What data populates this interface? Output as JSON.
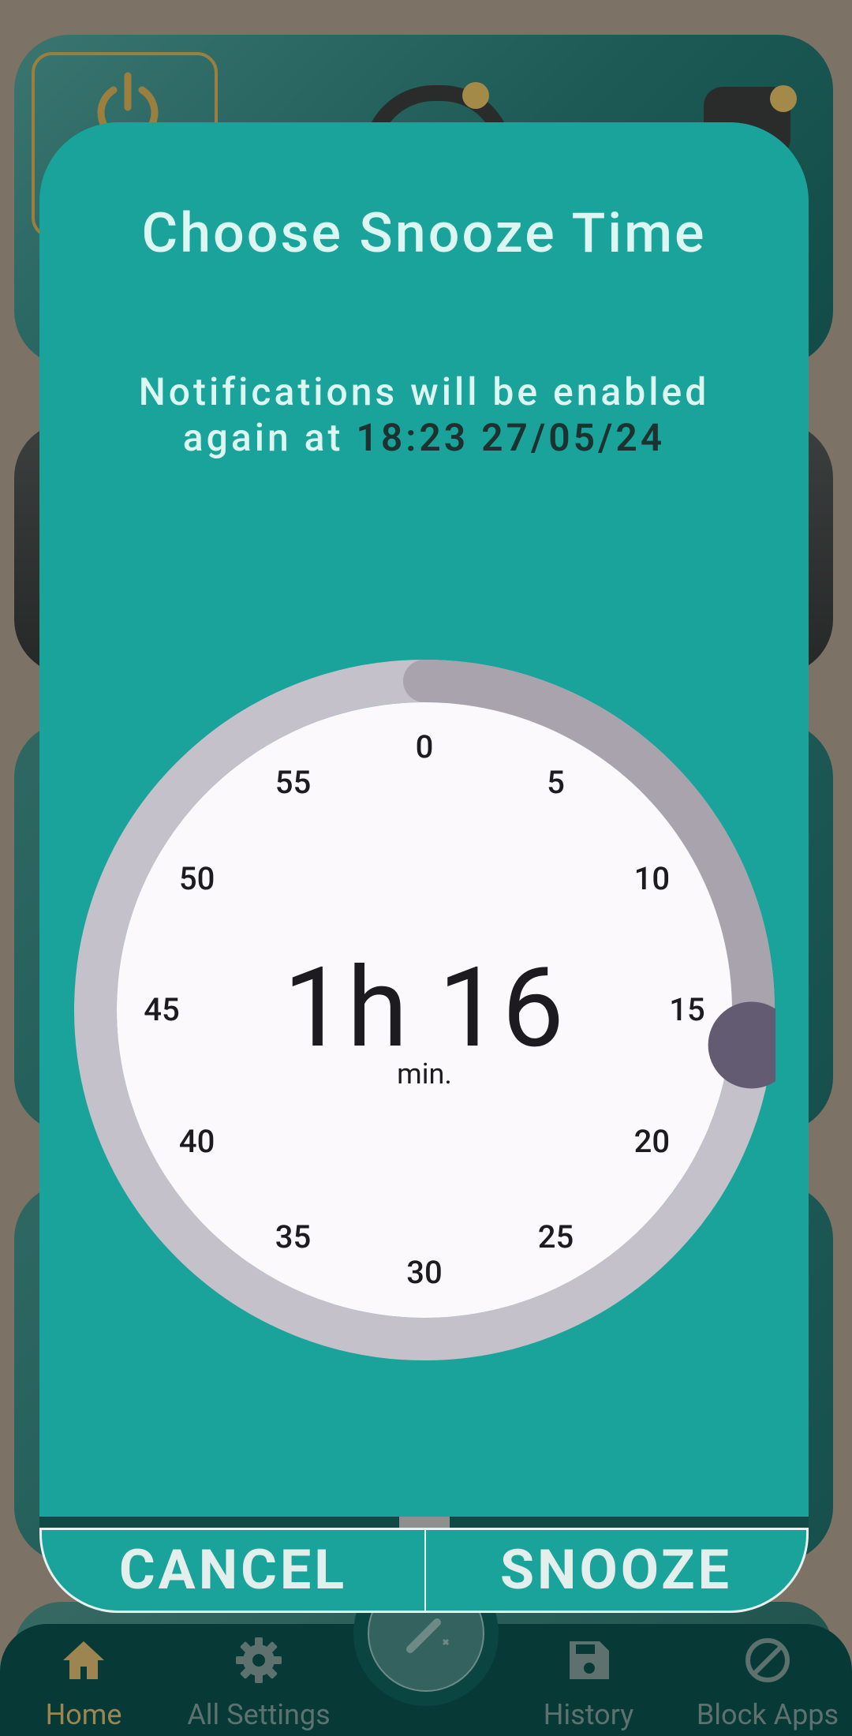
{
  "background": {
    "nav": {
      "items": [
        {
          "label": "Home",
          "icon": "home-icon"
        },
        {
          "label": "All Settings",
          "icon": "gear-icon"
        },
        {
          "label": "History",
          "icon": "save-icon"
        },
        {
          "label": "Block Apps",
          "icon": "block-icon"
        }
      ],
      "fab_icon": "magic-wand-icon"
    }
  },
  "dialog": {
    "title": "Choose Snooze Time",
    "message_prefix": "Notifications will be enabled",
    "message_line2_prefix": "again at ",
    "reenable_datetime": "18:23 27/05/24",
    "dial": {
      "labels": [
        "0",
        "5",
        "10",
        "15",
        "20",
        "25",
        "30",
        "35",
        "40",
        "45",
        "50",
        "55"
      ],
      "value": "1h 16",
      "unit": "min.",
      "progress_fraction": 0.267
    },
    "buttons": {
      "cancel": "CANCEL",
      "snooze": "SNOOZE"
    }
  },
  "colors": {
    "dialog_bg": "#1aa39a",
    "title_text": "#dcf6f2",
    "dial_track": "#c4c1cb",
    "dial_progress": "#a9a3ae",
    "dial_face": "#fcf9fc",
    "handle": "#625b71",
    "nav_bg": "#073a37",
    "nav_active": "#9c8550"
  }
}
